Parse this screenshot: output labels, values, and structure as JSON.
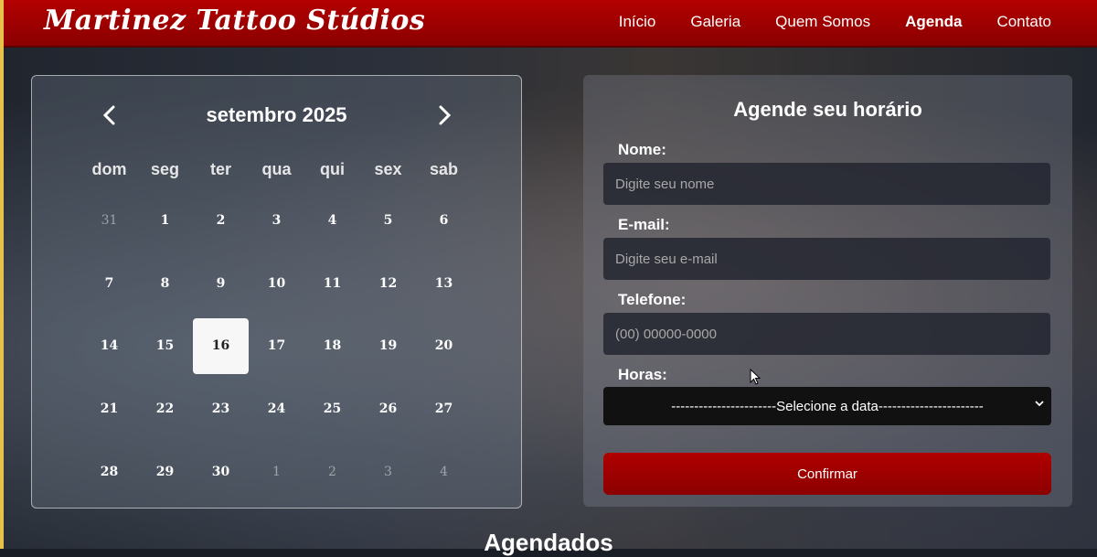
{
  "header": {
    "logo": "Martinez Tattoo Stúdios",
    "nav": [
      "Início",
      "Galeria",
      "Quem Somos",
      "Agenda",
      "Contato"
    ]
  },
  "calendar": {
    "month_label": "setembro 2025",
    "weekdays": [
      "dom",
      "seg",
      "ter",
      "qua",
      "qui",
      "sex",
      "sab"
    ],
    "weeks": [
      [
        "31",
        "1",
        "2",
        "3",
        "4",
        "5",
        "6"
      ],
      [
        "7",
        "8",
        "9",
        "10",
        "11",
        "12",
        "13"
      ],
      [
        "14",
        "15",
        "16",
        "17",
        "18",
        "19",
        "20"
      ],
      [
        "21",
        "22",
        "23",
        "24",
        "25",
        "26",
        "27"
      ],
      [
        "28",
        "29",
        "30",
        "1",
        "2",
        "3",
        "4"
      ]
    ],
    "selected_day": "16"
  },
  "form": {
    "title": "Agende seu horário",
    "name_label": "Nome:",
    "name_placeholder": "Digite seu nome",
    "email_label": "E-mail:",
    "email_placeholder": "Digite seu e-mail",
    "phone_label": "Telefone:",
    "phone_placeholder": "(00) 00000-0000",
    "hours_label": "Horas:",
    "hours_selected": "-----------------------Selecione a data-----------------------",
    "submit_label": "Confirmar"
  },
  "section_title": "Agendados",
  "colors": {
    "brand_red": "#a30000",
    "border_gold": "#e7c14a"
  }
}
